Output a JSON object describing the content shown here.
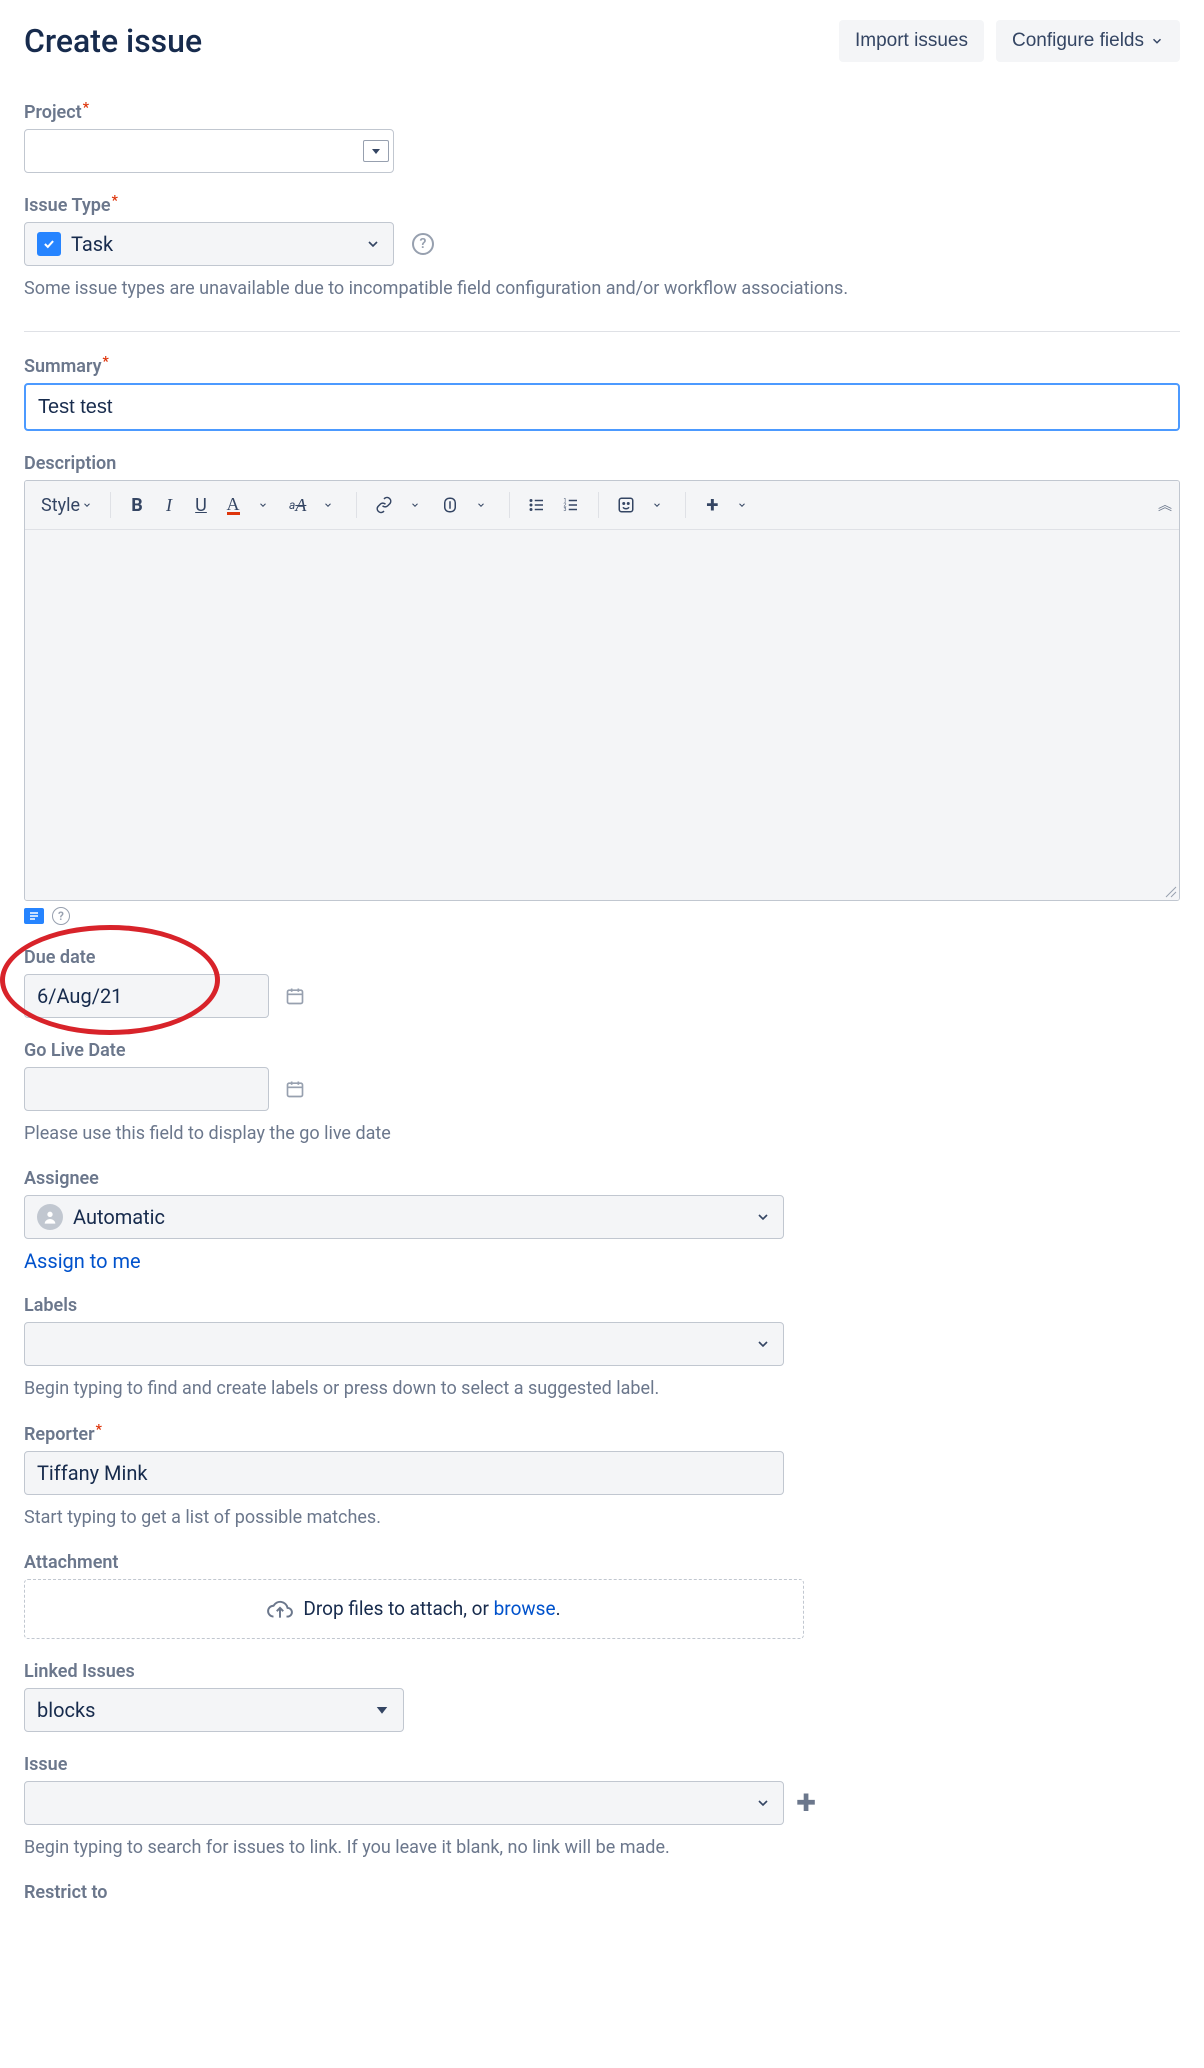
{
  "header": {
    "title": "Create issue",
    "import_btn": "Import issues",
    "configure_btn": "Configure fields"
  },
  "project": {
    "label": "Project",
    "value": ""
  },
  "issue_type": {
    "label": "Issue Type",
    "value": "Task",
    "hint": "Some issue types are unavailable due to incompatible field configuration and/or workflow associations."
  },
  "summary": {
    "label": "Summary",
    "value": "Test test"
  },
  "description": {
    "label": "Description",
    "style_btn": "Style"
  },
  "due_date": {
    "label": "Due date",
    "value": "6/Aug/21"
  },
  "go_live": {
    "label": "Go Live Date",
    "value": "",
    "hint": "Please use this field to display the go live date"
  },
  "assignee": {
    "label": "Assignee",
    "value": "Automatic",
    "assign_me": "Assign to me"
  },
  "labels": {
    "label": "Labels",
    "hint": "Begin typing to find and create labels or press down to select a suggested label."
  },
  "reporter": {
    "label": "Reporter",
    "value": "Tiffany Mink",
    "hint": "Start typing to get a list of possible matches."
  },
  "attachment": {
    "label": "Attachment",
    "drop_text": "Drop files to attach, or ",
    "browse": "browse"
  },
  "linked": {
    "label": "Linked Issues",
    "value": "blocks"
  },
  "issue": {
    "label": "Issue",
    "hint": "Begin typing to search for issues to link. If you leave it blank, no link will be made."
  },
  "restrict": {
    "label": "Restrict to"
  }
}
